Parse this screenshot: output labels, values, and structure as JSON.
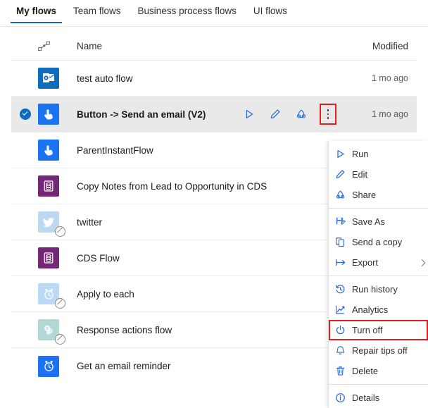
{
  "tabs": [
    {
      "label": "My flows",
      "active": true
    },
    {
      "label": "Team flows",
      "active": false
    },
    {
      "label": "Business process flows",
      "active": false
    },
    {
      "label": "UI flows",
      "active": false
    }
  ],
  "table": {
    "headers": {
      "type_icon": "flow-connector-icon",
      "name": "Name",
      "modified": "Modified"
    },
    "rows": [
      {
        "name": "test auto flow",
        "modified": "1 mo ago",
        "icon": "outlook-icon",
        "icon_color": "#0f6cbd",
        "selected": false,
        "disabled": false
      },
      {
        "name": "Button -> Send an email (V2)",
        "modified": "1 mo ago",
        "icon": "button-touch-icon",
        "icon_color": "#1b72f2",
        "selected": true,
        "disabled": false
      },
      {
        "name": "ParentInstantFlow",
        "modified": "",
        "icon": "button-touch-icon",
        "icon_color": "#1b72f2",
        "selected": false,
        "disabled": false
      },
      {
        "name": "Copy Notes from Lead to Opportunity in CDS",
        "modified": "",
        "icon": "database-icon",
        "icon_color": "#742774",
        "selected": false,
        "disabled": false
      },
      {
        "name": "twitter",
        "modified": "",
        "icon": "twitter-icon",
        "icon_color": "#bdd9f2",
        "selected": false,
        "disabled": true
      },
      {
        "name": "CDS Flow",
        "modified": "",
        "icon": "database-icon",
        "icon_color": "#742774",
        "selected": false,
        "disabled": false
      },
      {
        "name": "Apply to each",
        "modified": "",
        "icon": "clock-icon",
        "icon_color": "#bcd8f7",
        "selected": false,
        "disabled": true
      },
      {
        "name": "Response actions flow",
        "modified": "",
        "icon": "sharepoint-icon",
        "icon_color": "#b3d7d5",
        "selected": false,
        "disabled": true
      },
      {
        "name": "Get an email reminder",
        "modified": "",
        "icon": "clock-icon",
        "icon_color": "#1b72f2",
        "selected": false,
        "disabled": false
      }
    ]
  },
  "row_actions": {
    "run": "run-icon",
    "edit": "edit-pencil-icon",
    "share": "share-icon",
    "more": "more-vertical-ellipsis-icon"
  },
  "context_menu": {
    "items": [
      {
        "label": "Run",
        "icon": "play-triangle-icon",
        "submenu": false,
        "highlight": false,
        "divider_after": false
      },
      {
        "label": "Edit",
        "icon": "pencil-icon",
        "submenu": false,
        "highlight": false,
        "divider_after": false
      },
      {
        "label": "Share",
        "icon": "share-icon",
        "submenu": false,
        "highlight": false,
        "divider_after": true
      },
      {
        "label": "Save As",
        "icon": "save-as-icon",
        "submenu": false,
        "highlight": false,
        "divider_after": false
      },
      {
        "label": "Send a copy",
        "icon": "copy-icon",
        "submenu": false,
        "highlight": false,
        "divider_after": false
      },
      {
        "label": "Export",
        "icon": "export-arrow-icon",
        "submenu": true,
        "highlight": false,
        "divider_after": true
      },
      {
        "label": "Run history",
        "icon": "history-clock-icon",
        "submenu": false,
        "highlight": false,
        "divider_after": false
      },
      {
        "label": "Analytics",
        "icon": "analytics-chart-icon",
        "submenu": false,
        "highlight": false,
        "divider_after": false
      },
      {
        "label": "Turn off",
        "icon": "power-icon",
        "submenu": false,
        "highlight": true,
        "divider_after": false
      },
      {
        "label": "Repair tips off",
        "icon": "bell-icon",
        "submenu": false,
        "highlight": false,
        "divider_after": false
      },
      {
        "label": "Delete",
        "icon": "trash-icon",
        "submenu": false,
        "highlight": false,
        "divider_after": true
      },
      {
        "label": "Details",
        "icon": "info-circle-icon",
        "submenu": false,
        "highlight": false,
        "divider_after": false
      }
    ]
  },
  "colors": {
    "accent": "#0f6cbd",
    "menu_icon": "#2266dd",
    "highlight_border": "#e02020",
    "selected_row_bg": "#e9e9e9"
  }
}
